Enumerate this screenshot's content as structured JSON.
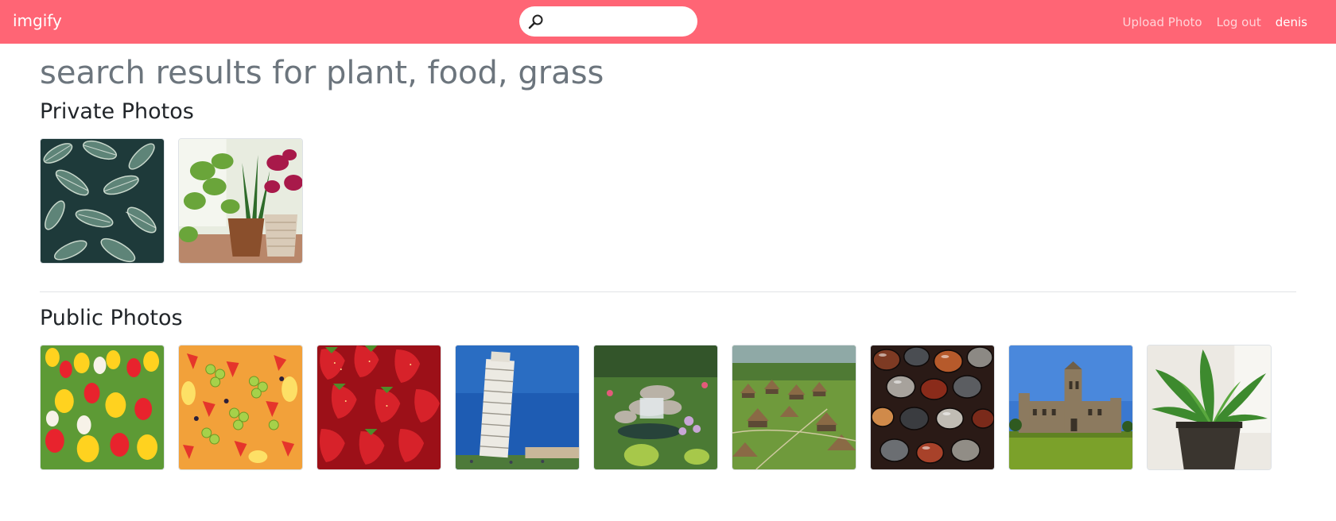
{
  "navbar": {
    "brand": "imgify",
    "search": {
      "value": "",
      "placeholder": ""
    },
    "links": {
      "upload": "Upload Photo",
      "logout": "Log out",
      "user": "denis"
    }
  },
  "main": {
    "title": "search results for plant, food, grass",
    "private": {
      "heading": "Private Photos",
      "photos": [
        "striped-leaves-photo",
        "potted-houseplants-photo"
      ]
    },
    "public": {
      "heading": "Public Photos",
      "photos": [
        "tulips-photo",
        "fruit-platter-photo",
        "strawberries-photo",
        "leaning-tower-photo",
        "garden-waterfall-photo",
        "village-huts-photo",
        "polished-stones-photo",
        "university-building-photo",
        "peace-lily-photo"
      ]
    }
  },
  "colors": {
    "navbar": "#ff6575",
    "title": "#6c757d",
    "text": "#212529"
  }
}
